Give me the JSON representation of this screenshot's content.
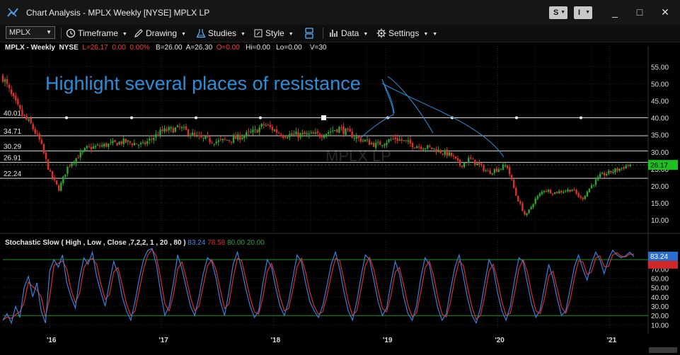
{
  "window": {
    "title": "Chart Analysis - MPLX Weekly [NYSE] MPLX LP",
    "btn_s": "S",
    "btn_i": "I",
    "minimize": "_",
    "maximize": "□",
    "close": "✕"
  },
  "toolbar": {
    "symbol": "MPLX",
    "timeframe": "Timeframe",
    "drawing": "Drawing",
    "studies": "Studies",
    "style": "Style",
    "data": "Data",
    "settings": "Settings"
  },
  "info_line": {
    "symbol": "MPLX - Weekly",
    "exchange": "NYSE",
    "last": "L=26.17",
    "change": "0.00",
    "change_pct": "0.00%",
    "bid": "B=26.00",
    "ask": "A=26.30",
    "open": "O=0.00",
    "hi": "Hi=0.00",
    "lo": "Lo=0.00",
    "volume": "V=30"
  },
  "colors": {
    "up": "#2fa52f",
    "down": "#e0302a",
    "annotation": "#2a8fd8",
    "last_price_bg": "#1fbf1f",
    "k_line": "#3a7fe0",
    "d_line": "#e02a2a",
    "band": "#1f8f1f"
  },
  "annotation": {
    "text": "Highlight several places of resistance"
  },
  "watermark": {
    "text": "MPLX LP"
  },
  "chart_data": [
    {
      "type": "candlestick",
      "title": "MPLX - Weekly",
      "x_ticks": [
        "'16",
        "'17",
        "'18",
        "'19",
        "'20",
        "'21"
      ],
      "y_ticks": [
        "55.00",
        "50.00",
        "45.00",
        "40.00",
        "35.00",
        "30.00",
        "25.00",
        "20.00",
        "15.00",
        "10.00"
      ],
      "ylim": [
        6.5,
        59
      ],
      "last_price": "26.17",
      "resistance_levels": [
        {
          "value": 40.01,
          "label": "40.01"
        },
        {
          "value": 34.71,
          "label": "34.71"
        },
        {
          "value": 30.29,
          "label": "30.29"
        },
        {
          "value": 26.91,
          "label": "26.91"
        },
        {
          "value": 22.24,
          "label": "22.24"
        }
      ],
      "close_path": [
        [
          "2015-08",
          52
        ],
        [
          "2015-09",
          46
        ],
        [
          "2015-10",
          41
        ],
        [
          "2015-11",
          38
        ],
        [
          "2015-12",
          33
        ],
        [
          "2016-01",
          24
        ],
        [
          "2016-02",
          19
        ],
        [
          "2016-03",
          26
        ],
        [
          "2016-05",
          31
        ],
        [
          "2016-07",
          32
        ],
        [
          "2016-09",
          33
        ],
        [
          "2016-11",
          32
        ],
        [
          "2017-01",
          36
        ],
        [
          "2017-03",
          37
        ],
        [
          "2017-05",
          34
        ],
        [
          "2017-07",
          33
        ],
        [
          "2017-09",
          34
        ],
        [
          "2017-11",
          36
        ],
        [
          "2017-12",
          38
        ],
        [
          "2018-02",
          35
        ],
        [
          "2018-04",
          35
        ],
        [
          "2018-06",
          35
        ],
        [
          "2018-08",
          37
        ],
        [
          "2018-10",
          34
        ],
        [
          "2018-12",
          32
        ],
        [
          "2019-02",
          34
        ],
        [
          "2019-04",
          32
        ],
        [
          "2019-06",
          31
        ],
        [
          "2019-08",
          29
        ],
        [
          "2019-09",
          26
        ],
        [
          "2019-10",
          28
        ],
        [
          "2019-12",
          24
        ],
        [
          "2020-02",
          26
        ],
        [
          "2020-03",
          17
        ],
        [
          "2020-04",
          11
        ],
        [
          "2020-05",
          16
        ],
        [
          "2020-06",
          19
        ],
        [
          "2020-07",
          18
        ],
        [
          "2020-09",
          19
        ],
        [
          "2020-10",
          16
        ],
        [
          "2020-11",
          20
        ],
        [
          "2020-12",
          23
        ],
        [
          "2021-01",
          24
        ],
        [
          "2021-02",
          25
        ],
        [
          "2021-03",
          26.17
        ]
      ]
    },
    {
      "type": "line",
      "title": "Stochastic Slow ( High , Low , Close ,7,2,2, 1 , 20 , 80 )",
      "series": [
        {
          "name": "83.24",
          "last": 83.24
        },
        {
          "name": "78.58",
          "last": 78.58
        }
      ],
      "bands": [
        "80.00",
        "20.00"
      ],
      "y_ticks": [
        "80.00",
        "70.00",
        "60.00",
        "50.00",
        "40.00",
        "30.00",
        "20.00",
        "10.00"
      ],
      "ylim": [
        5,
        93
      ],
      "k_values": [
        15,
        22,
        12,
        30,
        18,
        50,
        62,
        40,
        55,
        25,
        12,
        68,
        80,
        72,
        85,
        55,
        40,
        28,
        60,
        82,
        75,
        88,
        62,
        45,
        30,
        55,
        78,
        65,
        40,
        25,
        15,
        35,
        60,
        80,
        90,
        92,
        75,
        45,
        20,
        30,
        55,
        85,
        70,
        50,
        30,
        20,
        40,
        65,
        82,
        78,
        60,
        35,
        20,
        45,
        75,
        88,
        70,
        48,
        30,
        18,
        25,
        55,
        80,
        72,
        50,
        30,
        20,
        35,
        60,
        85,
        78,
        55,
        35,
        25,
        18,
        30,
        52,
        75,
        88,
        70,
        45,
        25,
        15,
        35,
        62,
        85,
        80,
        58,
        35,
        20,
        28,
        55,
        78,
        65,
        40,
        22,
        15,
        30,
        60,
        82,
        75,
        50,
        28,
        15,
        22,
        48,
        72,
        85,
        62,
        38,
        20,
        12,
        28,
        55,
        80,
        70,
        45,
        25,
        15,
        30,
        58,
        82,
        78,
        55,
        32,
        18,
        26,
        50,
        75,
        60,
        38,
        20,
        25,
        48,
        72,
        85,
        70,
        58,
        75,
        88,
        80,
        65,
        80,
        90,
        85,
        82,
        84,
        88,
        83.24
      ]
    }
  ]
}
